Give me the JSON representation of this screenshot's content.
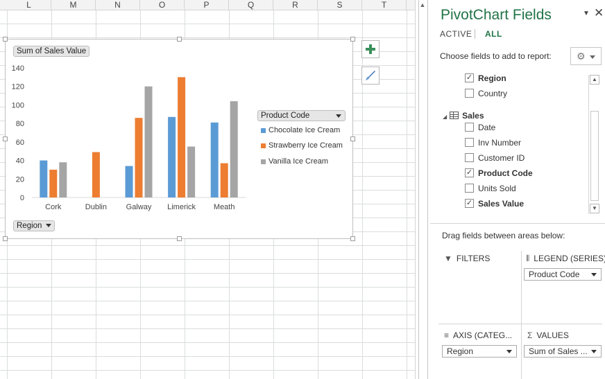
{
  "sheet": {
    "columns": [
      "L",
      "M",
      "N",
      "O",
      "P",
      "Q",
      "R",
      "S",
      "T"
    ]
  },
  "chart": {
    "values_field_button": "Sum of Sales Value",
    "axis_field_button": "Region",
    "legend_field_button": "Product Code",
    "side_buttons": {
      "elements_icon": "plus-icon",
      "styles_icon": "paintbrush-icon"
    }
  },
  "chart_data": {
    "type": "bar",
    "categories": [
      "Cork",
      "Dublin",
      "Galway",
      "Limerick",
      "Meath"
    ],
    "series": [
      {
        "name": "Chocolate Ice Cream",
        "color": "#5b9bd5",
        "values": [
          40,
          null,
          34,
          87,
          81
        ]
      },
      {
        "name": "Strawberry Ice Cream",
        "color": "#ed7d31",
        "values": [
          30,
          49,
          86,
          130,
          37
        ]
      },
      {
        "name": "Vanilla Ice Cream",
        "color": "#a5a5a5",
        "values": [
          38,
          null,
          120,
          55,
          104
        ]
      }
    ],
    "y_ticks": [
      "0",
      "20",
      "40",
      "60",
      "80",
      "100",
      "120",
      "140"
    ],
    "ylim": [
      0,
      140
    ],
    "grid": false,
    "legend_position": "right"
  },
  "pane": {
    "title": "PivotChart Fields",
    "tabs": {
      "active": "ACTIVE",
      "all": "ALL"
    },
    "choose_label": "Choose fields to add to report:",
    "fields": [
      {
        "label": "Region",
        "checked": true,
        "bold": true
      },
      {
        "label": "Country",
        "checked": false,
        "bold": false
      }
    ],
    "table_name": "Sales",
    "sales_fields": [
      {
        "label": "Date",
        "checked": false,
        "bold": false
      },
      {
        "label": "Inv Number",
        "checked": false,
        "bold": false
      },
      {
        "label": "Customer ID",
        "checked": false,
        "bold": false
      },
      {
        "label": "Product Code",
        "checked": true,
        "bold": true
      },
      {
        "label": "Units Sold",
        "checked": false,
        "bold": false
      },
      {
        "label": "Sales Value",
        "checked": true,
        "bold": true
      }
    ],
    "drag_label": "Drag fields between areas below:",
    "areas": {
      "filters": {
        "title": "FILTERS"
      },
      "legend": {
        "title": "LEGEND (SERIES)",
        "value": "Product Code"
      },
      "axis": {
        "title": "AXIS (CATEG...",
        "value": "Region"
      },
      "values": {
        "title": "VALUES",
        "value": "Sum of Sales ..."
      }
    }
  }
}
